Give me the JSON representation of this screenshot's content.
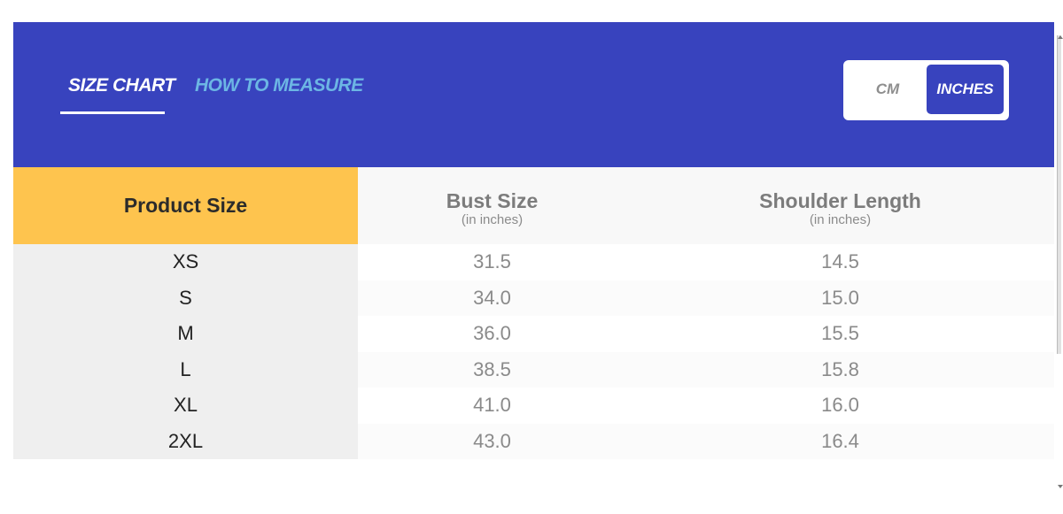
{
  "tabs": {
    "size_chart": "SIZE CHART",
    "how_to_measure": "HOW TO MEASURE",
    "active": "size_chart"
  },
  "unit_toggle": {
    "cm": "CM",
    "inches": "INCHES",
    "selected": "inches"
  },
  "table": {
    "headers": {
      "product_size": "Product Size",
      "bust_size": "Bust Size",
      "bust_unit": "(in inches)",
      "shoulder_length": "Shoulder Length",
      "shoulder_unit": "(in inches)"
    },
    "rows": [
      {
        "size": "XS",
        "bust": "31.5",
        "shoulder": "14.5"
      },
      {
        "size": "S",
        "bust": "34.0",
        "shoulder": "15.0"
      },
      {
        "size": "M",
        "bust": "36.0",
        "shoulder": "15.5"
      },
      {
        "size": "L",
        "bust": "38.5",
        "shoulder": "15.8"
      },
      {
        "size": "XL",
        "bust": "41.0",
        "shoulder": "16.0"
      },
      {
        "size": "2XL",
        "bust": "43.0",
        "shoulder": "16.4"
      }
    ]
  },
  "colors": {
    "header_bg": "#3843be",
    "active_tab": "#ffffff",
    "inactive_tab": "#6cb6e4",
    "product_size_header": "#fec44e"
  }
}
